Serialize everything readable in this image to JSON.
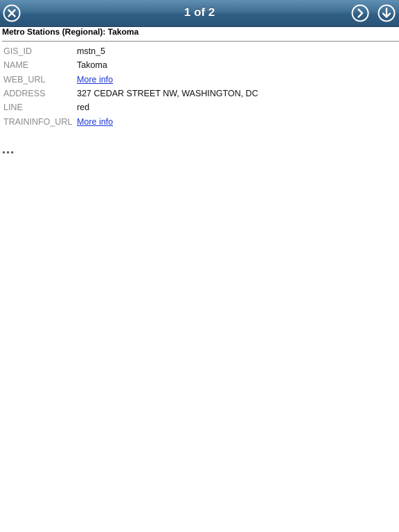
{
  "titlebar": {
    "title": "1 of 2",
    "close_icon": "close-circle-icon",
    "next_icon": "chevron-right-circle-icon",
    "download_icon": "arrow-down-circle-icon",
    "gradient_top": "#5f8fb2",
    "gradient_bottom": "#2a5478"
  },
  "layer": {
    "heading": "Metro Stations (Regional): Takoma"
  },
  "attributes": [
    {
      "key": "GIS_ID",
      "value": "mstn_5",
      "is_link": false
    },
    {
      "key": "NAME",
      "value": "Takoma",
      "is_link": false
    },
    {
      "key": "WEB_URL",
      "value": "More info",
      "is_link": true
    },
    {
      "key": "ADDRESS",
      "value": "327 CEDAR STREET NW, WASHINGTON, DC",
      "is_link": false
    },
    {
      "key": "LINE",
      "value": "red",
      "is_link": false
    },
    {
      "key": "TRAININFO_URL",
      "value": "More info",
      "is_link": true
    }
  ],
  "more_icon": "ellipsis-icon",
  "colors": {
    "key_text": "#8a8a8a",
    "link": "#1a36d6"
  }
}
